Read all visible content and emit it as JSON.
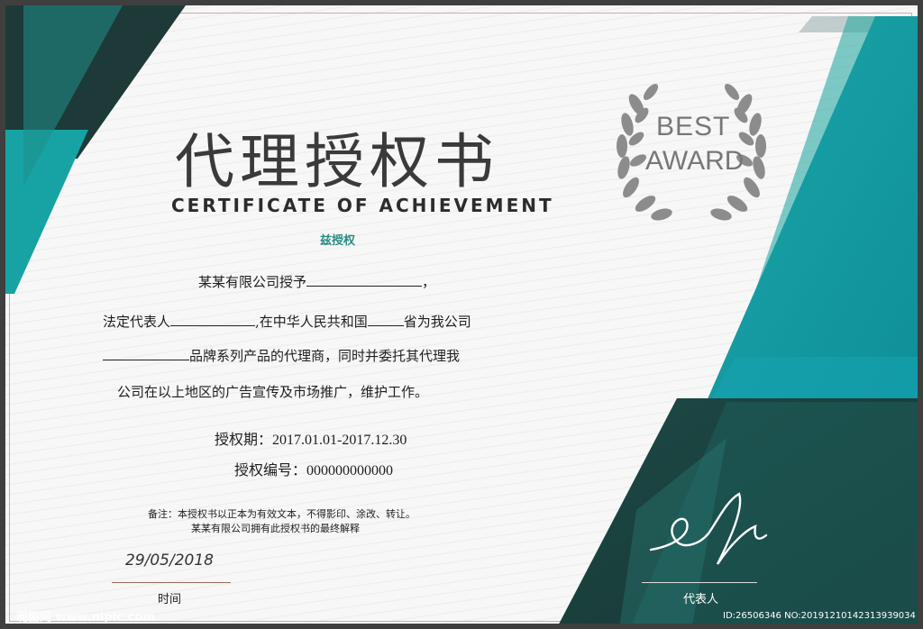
{
  "certificate": {
    "title": "代理授权书",
    "subtitle": "CERTIFICATE OF ACHIEVEMENT",
    "tagline": "兹授权",
    "badge": {
      "line1": "BEST",
      "line2": "AWARD"
    },
    "body": {
      "line1_text": "某某有限公司授予",
      "line1_end": "，",
      "line2_a": "法定代表人",
      "line2_b": ",在中华人民共和国",
      "line2_c": "省为我公司",
      "line3_text": "品牌系列产品的代理商，同时并委托其代理我",
      "line4_text": "公司在以上地区的广告宣传及市场推广，维护工作。"
    },
    "term": {
      "label": "授权期：",
      "value": "2017.01.01-2017.12.30"
    },
    "number": {
      "label": "授权编号：",
      "value": "000000000000"
    },
    "notes": {
      "line1": "备注：本授权书以正本为有效文本，不得影印、涂改、转让。",
      "line2": "某某有限公司拥有此授权书的最终解释"
    },
    "date": {
      "value": "29/05/2018",
      "label": "时间"
    },
    "signature": {
      "label": "代表人"
    },
    "colors": {
      "teal": "#1f9c9c",
      "dark_teal": "#1c3a38",
      "aqua": "#13a5b0",
      "laurel": "#8a8a8a"
    }
  },
  "watermark": {
    "left": "昵图网 www.nipic.com",
    "right": "ID:26506346 NO:20191210142313939034"
  }
}
